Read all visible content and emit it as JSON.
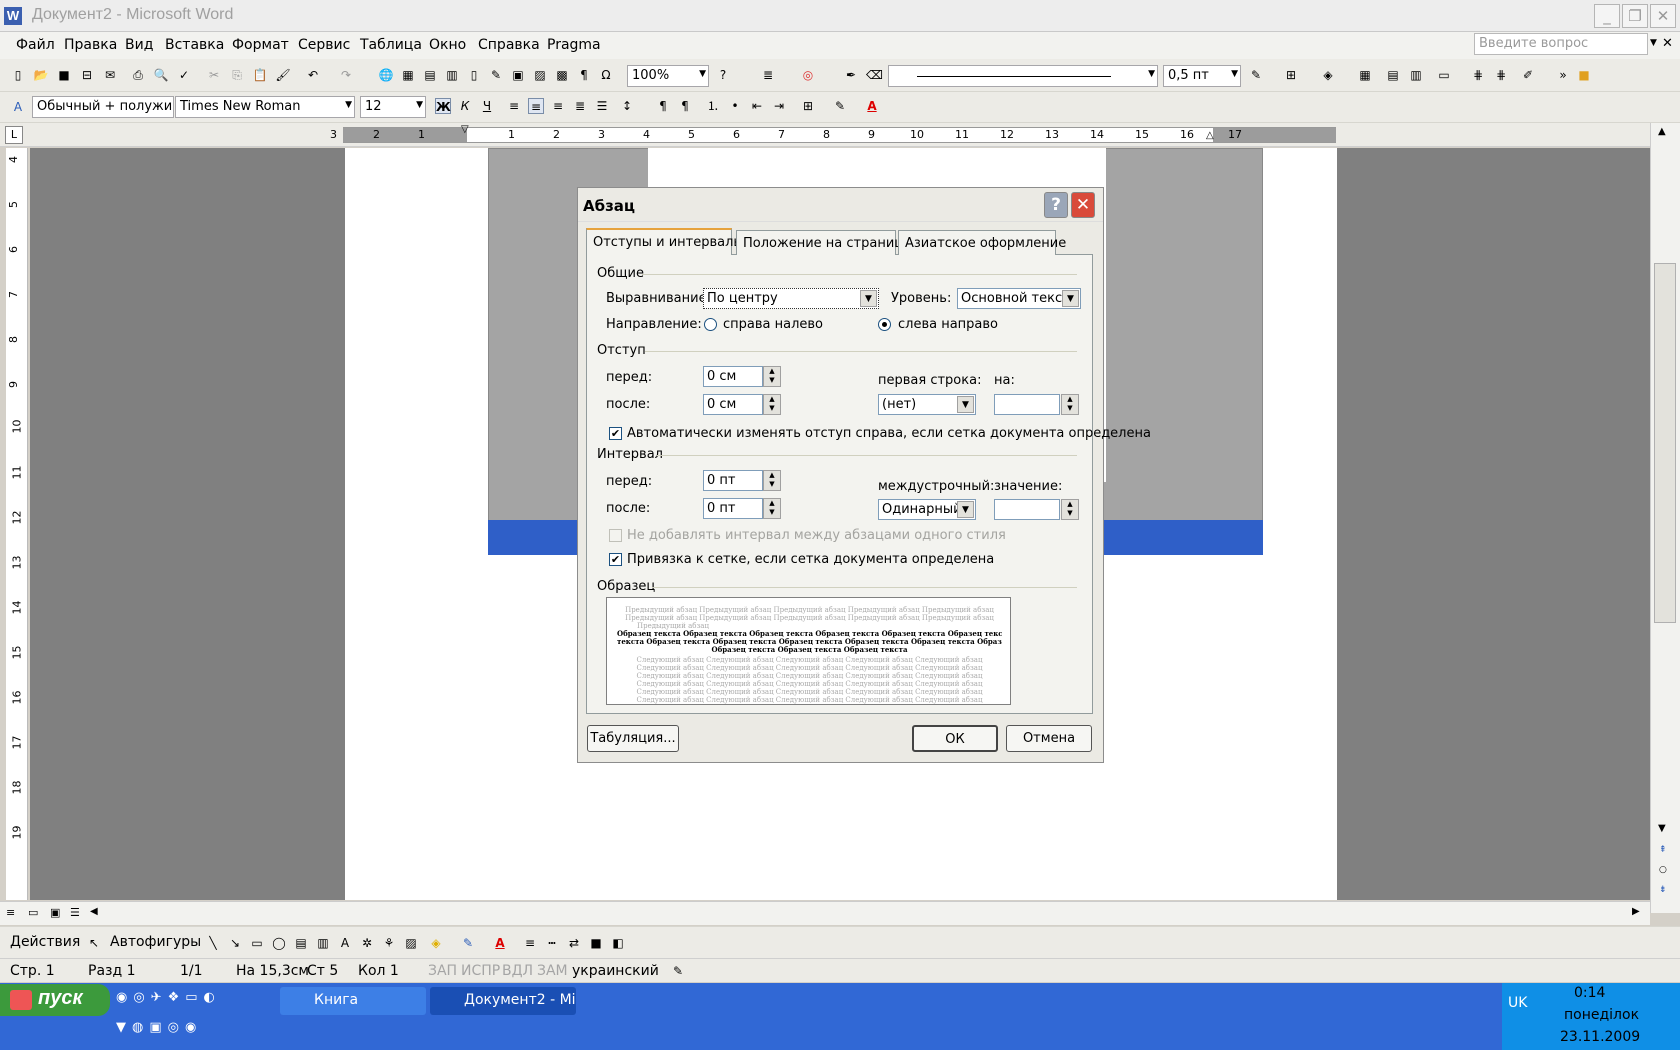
{
  "window": {
    "title": "Документ2 - Microsoft Word",
    "app_icon": "W"
  },
  "menu": [
    "Файл",
    "Правка",
    "Вид",
    "Вставка",
    "Формат",
    "Сервис",
    "Таблица",
    "Окно",
    "Справка",
    "Pragma"
  ],
  "ask_placeholder": "Введите вопрос",
  "toolbar": {
    "zoom": "100%",
    "line_weight": "0,5 пт"
  },
  "format_bar": {
    "style": "Обычный + полужи",
    "font": "Times New Roman",
    "size": "12",
    "bold": "Ж",
    "italic": "К",
    "underline": "Ч"
  },
  "ruler": {
    "left_numbers": [
      "3",
      "2",
      "1"
    ],
    "right_numbers": [
      "1",
      "2",
      "3",
      "4",
      "5",
      "6",
      "7",
      "8",
      "9",
      "10",
      "11",
      "12",
      "13",
      "14",
      "15",
      "16",
      "17"
    ],
    "vertical_numbers": [
      "4",
      "5",
      "6",
      "7",
      "8",
      "9",
      "10",
      "11",
      "12",
      "13",
      "14",
      "15",
      "16",
      "17",
      "18",
      "19"
    ]
  },
  "dialog": {
    "title": "Абзац",
    "help_glyph": "?",
    "close_glyph": "✕",
    "tabs": [
      "Отступы и интервалы",
      "Положение на странице",
      "Азиатское оформление"
    ],
    "general": {
      "section": "Общие",
      "alignment_label": "Выравнивание:",
      "alignment_value": "По центру",
      "level_label": "Уровень:",
      "level_value": "Основной текст",
      "direction_label": "Направление:",
      "dir_rtl": "справа налево",
      "dir_ltr": "слева направо",
      "direction_selected": "слева направо"
    },
    "indent": {
      "section": "Отступ",
      "before_label": "перед:",
      "before_value": "0 см",
      "after_label": "после:",
      "after_value": "0 см",
      "first_line_label": "первая строка:",
      "first_line_value": "(нет)",
      "by_label": "на:",
      "by_value": "",
      "auto_label": "Автоматически изменять отступ справа, если сетка документа определена",
      "auto_checked": true
    },
    "spacing": {
      "section": "Интервал",
      "before_label": "перед:",
      "before_value": "0 пт",
      "after_label": "после:",
      "after_value": "0 пт",
      "line_label": "междустрочный:",
      "line_value": "Одинарный",
      "value_label": "значение:",
      "value_value": "",
      "no_space_label": "Не добавлять интервал между абзацами одного стиля",
      "no_space_checked": false,
      "snap_label": "Привязка к сетке, если сетка документа определена",
      "snap_checked": true
    },
    "preview": {
      "section": "Образец",
      "prev_lines": [
        "Предыдущий абзац Предыдущий абзац Предыдущий абзац Предыдущий абзац Предыдущий абзац",
        "Предыдущий абзац Предыдущий абзац Предыдущий абзац Предыдущий абзац Предыдущий абзац",
        "Предыдущий абзац"
      ],
      "sample_lines": [
        "Образец текста Образец текста Образец текста Образец текста Образец текста Образец текста",
        "текста Образец текста Образец текста Образец текста Образец текста Образец текста Образец текста",
        "Образец текста Образец текста Образец текста"
      ],
      "next_lines": [
        "Следующий абзац Следующий абзац Следующий абзац Следующий абзац Следующий абзац",
        "Следующий абзац Следующий абзац Следующий абзац Следующий абзац Следующий абзац",
        "Следующий абзац Следующий абзац Следующий абзац Следующий абзац Следующий абзац",
        "Следующий абзац Следующий абзац Следующий абзац Следующий абзац Следующий абзац",
        "Следующий абзац Следующий абзац Следующий абзац Следующий абзац Следующий абзац",
        "Следующий абзац Следующий абзац Следующий абзац Следующий абзац Следующий абзац"
      ]
    },
    "buttons": {
      "tabs": "Табуляция...",
      "ok": "ОК",
      "cancel": "Отмена"
    }
  },
  "drawbar": {
    "actions": "Действия",
    "autoshapes": "Автофигуры"
  },
  "status": {
    "page": "Стр. 1",
    "section": "Разд 1",
    "pages": "1/1",
    "at": "На 15,3см",
    "line": "Ст 5",
    "col": "Кол 1",
    "rec": "ЗАП",
    "trk": "ИСПР",
    "ext": "ВДЛ",
    "ovr": "ЗАМ",
    "lang": "украинский"
  },
  "taskbar": {
    "start": "пуск",
    "tasks": [
      "Книга",
      "Документ2 - Mi..."
    ],
    "lang": "UK",
    "time": "0:14",
    "day": "понеділок",
    "date": "23.11.2009"
  },
  "colors": {
    "title_bar": "#ededed",
    "taskbar": "#3168d5",
    "start": "#3c9a3c",
    "close": "#d94a3a",
    "tab_accent": "#e6a23c"
  }
}
